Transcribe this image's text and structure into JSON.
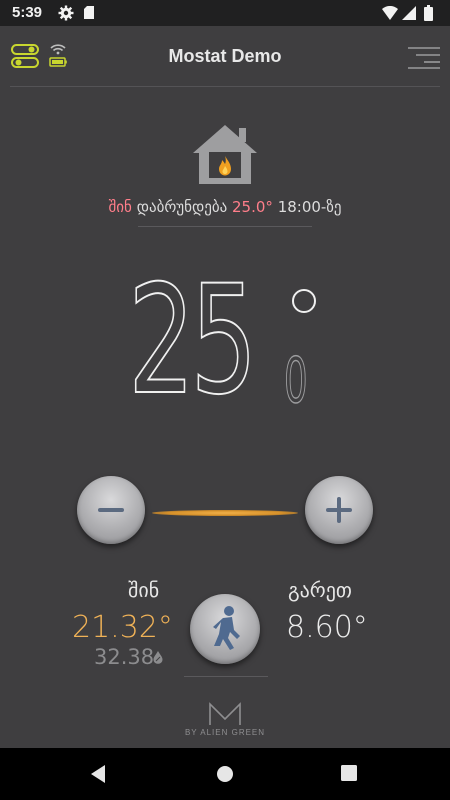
{
  "status_bar": {
    "time": "5:39"
  },
  "app_bar": {
    "title": "Mostat Demo"
  },
  "schedule": {
    "mode": "შინ",
    "returns": "დაბრუნდება",
    "temp": "25.0°",
    "time": "18:00-ზე"
  },
  "target": {
    "whole": "25",
    "decimal": "0"
  },
  "inside": {
    "label": "შინ",
    "temp": "21.32°",
    "humidity": "32.38"
  },
  "outside": {
    "label": "გარეთ",
    "temp": "8.60°"
  },
  "logo": {
    "text": "BY ALIEN GREEN"
  },
  "colors": {
    "accent": "#f0b257",
    "schedule": "#ff7e8a",
    "status_icon": "#c8d62f"
  }
}
